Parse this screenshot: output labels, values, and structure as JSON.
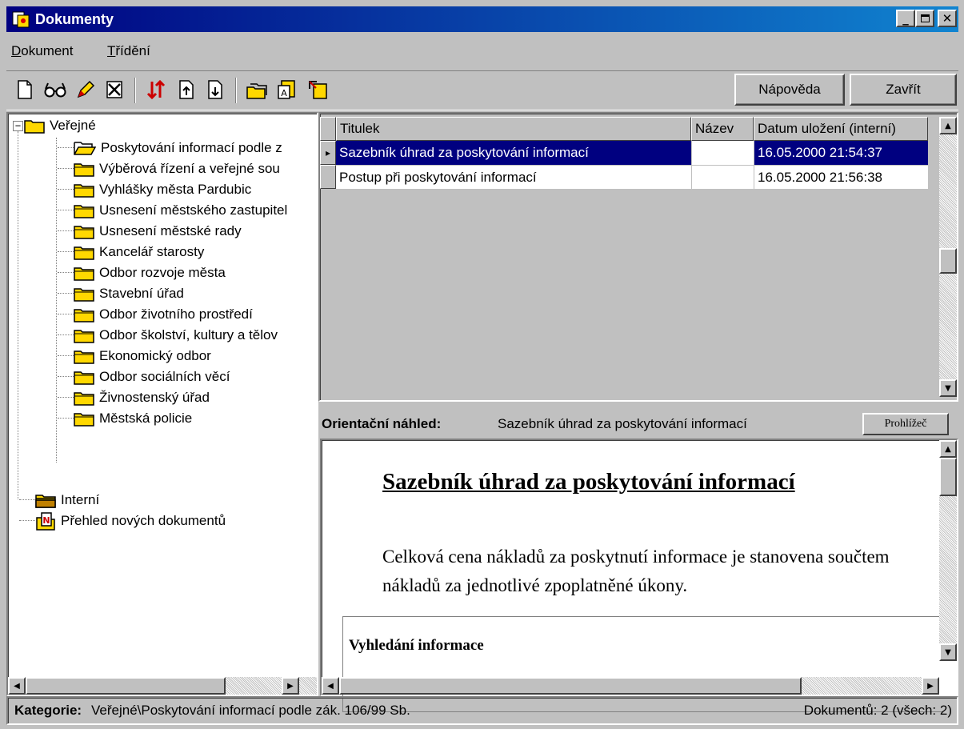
{
  "window": {
    "title": "Dokumenty"
  },
  "menu": {
    "items": [
      {
        "label": "Dokument",
        "accel": "D",
        "rest": "okument"
      },
      {
        "label": "Třídění",
        "accel": "T",
        "rest": "řídění"
      }
    ]
  },
  "toolbar": {
    "icons": [
      "new-document-icon",
      "view-icon",
      "edit-icon",
      "delete-icon",
      "sort-icon",
      "move-up-icon",
      "move-down-icon",
      "folders-icon",
      "export-icon",
      "import-icon"
    ],
    "help_label": "Nápověda",
    "close_label": "Zavřít"
  },
  "tree": {
    "root": "Veřejné",
    "children": [
      "Poskytování informací podle z",
      "Výběrová řízení a veřejné sou",
      "Vyhlášky města Pardubic",
      "Usnesení městského zastupitel",
      "Usnesení městské rady",
      "Kancelář starosty",
      "Odbor rozvoje města",
      "Stavební úřad",
      "Odbor životního prostředí",
      "Odbor školství, kultury a tělov",
      "Ekonomický odbor",
      "Odbor sociálních věcí",
      "Živnostenský úřad",
      "Městská policie"
    ],
    "others": [
      "Interní",
      "Přehled nových dokumentů"
    ]
  },
  "grid": {
    "columns": [
      "Titulek",
      "Název",
      "Datum uložení (interní)"
    ],
    "rows": [
      {
        "titulek": "Sazebník úhrad za poskytování informací",
        "nazev": "",
        "datum": "16.05.2000 21:54:37"
      },
      {
        "titulek": "Postup při poskytování informací",
        "nazev": "",
        "datum": "16.05.2000 21:56:38"
      }
    ]
  },
  "preview": {
    "label": "Orientační náhled:",
    "doc_name": "Sazebník úhrad za poskytování informací",
    "viewer_button": "Prohlížeč",
    "doc_title": "Sazebník úhrad za poskytování informací",
    "paragraph": "Celková cena nákladů za poskytnutí informace je stanovena součtem nákladů za jednotlivé zpoplatněné úkony.",
    "subheading": "Vyhledání informace"
  },
  "status": {
    "category_label": "Kategorie:",
    "category_value": "Veřejné\\Poskytování informací podle zák. 106/99 Sb.",
    "count": "Dokumentů: 2 (všech: 2)"
  },
  "colors": {
    "title_start": "#000080",
    "title_end": "#1084d0",
    "selection": "#000080",
    "folder": "#ffd800"
  }
}
